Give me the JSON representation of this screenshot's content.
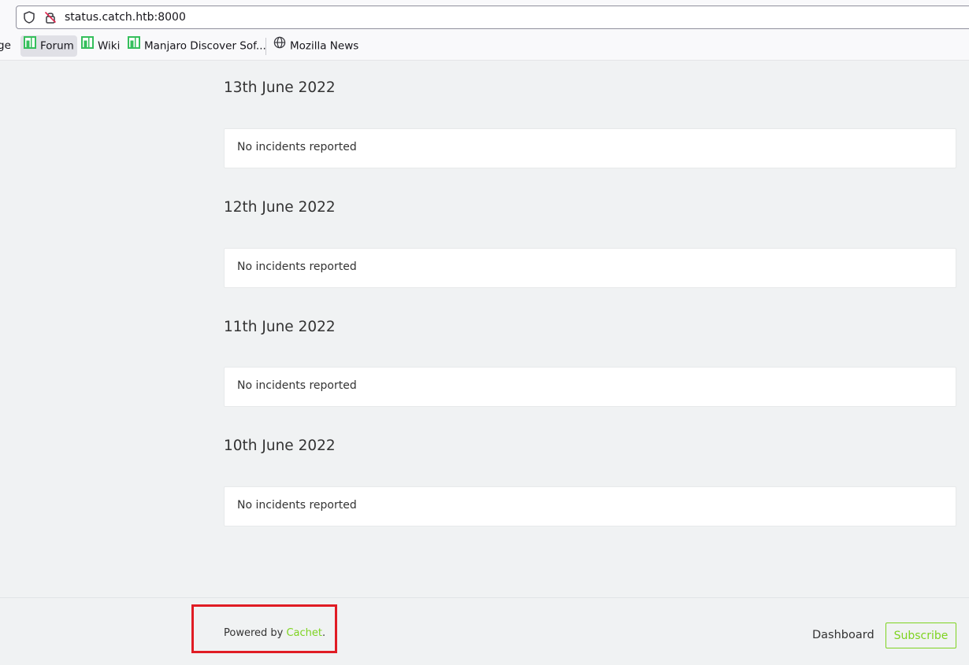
{
  "browser": {
    "url": "status.catch.htb:8000",
    "bookmarks": [
      {
        "label": "ge",
        "icon": "page-icon"
      },
      {
        "label": "Forum",
        "icon": "manjaro-icon"
      },
      {
        "label": "Wiki",
        "icon": "manjaro-icon"
      },
      {
        "label": "Manjaro Discover Sof...",
        "icon": "manjaro-icon"
      },
      {
        "label": "Mozilla News",
        "icon": "globe-icon"
      }
    ],
    "colors": {
      "manjaro_green": "#35bf5c"
    }
  },
  "timeline": [
    {
      "date": "13th June 2022",
      "message": "No incidents reported"
    },
    {
      "date": "12th June 2022",
      "message": "No incidents reported"
    },
    {
      "date": "11th June 2022",
      "message": "No incidents reported"
    },
    {
      "date": "10th June 2022",
      "message": "No incidents reported"
    }
  ],
  "footer": {
    "powered_prefix": "Powered by ",
    "powered_link": "Cachet",
    "powered_suffix": ".",
    "dashboard_label": "Dashboard",
    "subscribe_label": "Subscribe",
    "accent_color": "#7ed321",
    "highlight_color": "#e01c24"
  }
}
